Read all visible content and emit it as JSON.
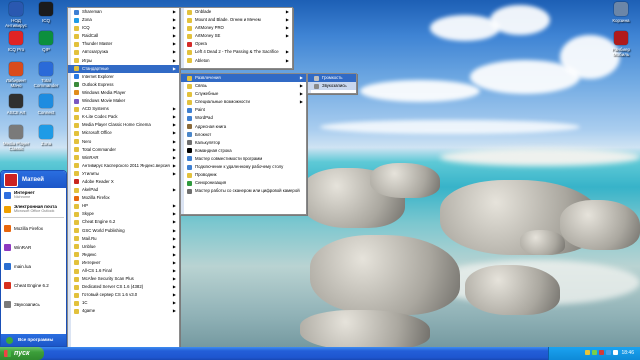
{
  "desktop": {
    "icons": [
      {
        "label": "НОД Антивирус",
        "color": "#2a58b0"
      },
      {
        "label": "ICQ",
        "color": "#1b1b1b"
      },
      {
        "label": "ICQ Pro",
        "color": "#e02424"
      },
      {
        "label": "QIP",
        "color": "#0c8f3e"
      },
      {
        "label": "Лабиринт Мачо",
        "color": "#d84b1c"
      },
      {
        "label": "Total Commander",
        "color": "#2a6ad8"
      },
      {
        "label": "ASCII Art",
        "color": "#303030"
      },
      {
        "label": "Connect",
        "color": "#1e8ce0"
      },
      {
        "label": "Media Player Classic",
        "color": "#7a7a7a"
      },
      {
        "label": "Zona",
        "color": "#1e9be6"
      }
    ],
    "right_icons": [
      {
        "label": "Корзина",
        "color": "#6b86a8"
      },
      {
        "label": "Ранбиер Мобиль",
        "color": "#b01b1b"
      }
    ]
  },
  "start_menu": {
    "user": "Матвей",
    "pinned": [
      {
        "title": "Интернет",
        "sub": "Nichrome",
        "color": "#2f6fe0"
      },
      {
        "title": "Электронная почта",
        "sub": "Microsoft Office Outlook",
        "color": "#f0a000"
      }
    ],
    "recent": [
      {
        "label": "Mozilla Firefox",
        "color": "#e8660d"
      },
      {
        "label": "WinRAR",
        "color": "#8e3ac0"
      },
      {
        "label": "main.lua",
        "color": "#2b6fd2"
      },
      {
        "label": "Cheat Engine 6.2",
        "color": "#d8301e"
      },
      {
        "label": "Звукозапись",
        "color": "#7a7a7a"
      }
    ],
    "all_programs": "Все программы"
  },
  "programs_menu": [
    {
      "label": "Shareman",
      "color": "#3d7fd3",
      "sub": true
    },
    {
      "label": "Zona",
      "color": "#1e9be6",
      "sub": true
    },
    {
      "label": "ICQ",
      "color": "#e2c13c",
      "sub": true
    },
    {
      "label": "RaidCall",
      "color": "#e2c13c",
      "sub": true
    },
    {
      "label": "Thunder Master",
      "color": "#e2c13c",
      "sub": true
    },
    {
      "label": "Автозагрузка",
      "color": "#e2c13c",
      "sub": true
    },
    {
      "label": "Игры",
      "color": "#e2c13c",
      "sub": true
    },
    {
      "label": "Стандартные",
      "color": "#e2c13c",
      "sub": true,
      "state": "hl"
    },
    {
      "label": "Internet Explorer",
      "color": "#2a7ae2",
      "sub": false
    },
    {
      "label": "Outlook Express",
      "color": "#3a8a3a",
      "sub": false
    },
    {
      "label": "Windows Media Player",
      "color": "#e08c1b",
      "sub": false
    },
    {
      "label": "Windows Movie Maker",
      "color": "#7a57c2",
      "sub": false
    },
    {
      "label": "ACD Systems",
      "color": "#e2c13c",
      "sub": true
    },
    {
      "label": "K-Lite Codec Pack",
      "color": "#e2c13c",
      "sub": true
    },
    {
      "label": "Media Player Classic Home Cinema",
      "color": "#e2c13c",
      "sub": true
    },
    {
      "label": "Microsoft Office",
      "color": "#e2c13c",
      "sub": true
    },
    {
      "label": "Nero",
      "color": "#e2c13c",
      "sub": true
    },
    {
      "label": "Total Commander",
      "color": "#e2c13c",
      "sub": true
    },
    {
      "label": "WinRAR",
      "color": "#e2c13c",
      "sub": true
    },
    {
      "label": "Антивирус Касперского 2011 Яндекс.версия",
      "color": "#e2c13c",
      "sub": true
    },
    {
      "label": "Утилиты",
      "color": "#e2c13c",
      "sub": true
    },
    {
      "label": "Adobe Reader X",
      "color": "#c8261e",
      "sub": false
    },
    {
      "label": "AkelPad",
      "color": "#e2c13c",
      "sub": true
    },
    {
      "label": "Mozilla Firefox",
      "color": "#e8660d",
      "sub": false
    },
    {
      "label": "HP",
      "color": "#e2c13c",
      "sub": true
    },
    {
      "label": "Skype",
      "color": "#e2c13c",
      "sub": true
    },
    {
      "label": "Cheat Engine 6.2",
      "color": "#e2c13c",
      "sub": true
    },
    {
      "label": "GSC World Publishing",
      "color": "#e2c13c",
      "sub": true
    },
    {
      "label": "Mail.Ru",
      "color": "#e2c13c",
      "sub": true
    },
    {
      "label": "Unblue",
      "color": "#e2c13c",
      "sub": true
    },
    {
      "label": "Яндекс",
      "color": "#e2c13c",
      "sub": true
    },
    {
      "label": "Интернет",
      "color": "#e2c13c",
      "sub": true
    },
    {
      "label": "All-CS 1.6 Final",
      "color": "#e2c13c",
      "sub": true
    },
    {
      "label": "McAfee Security Scan Plus",
      "color": "#e2c13c",
      "sub": true
    },
    {
      "label": "Dedicated Server CS 1.6 (4382)",
      "color": "#e2c13c",
      "sub": true
    },
    {
      "label": "Готовый сервер CS 1.6 v3.0",
      "color": "#e2c13c",
      "sub": true
    },
    {
      "label": "1C",
      "color": "#e2c13c",
      "sub": true
    },
    {
      "label": "4game",
      "color": "#e2c13c",
      "sub": true
    }
  ],
  "standard_top": [
    {
      "label": "Onblade",
      "color": "#e2c13c",
      "sub": true
    },
    {
      "label": "Mount and Blade. Огнем и Мечем",
      "color": "#e2c13c",
      "sub": true
    },
    {
      "label": "ArtMoney PRO",
      "color": "#e2c13c",
      "sub": true
    },
    {
      "label": "ArtMoney SE",
      "color": "#e2c13c",
      "sub": true
    },
    {
      "label": "Opera",
      "color": "#d42a2a",
      "sub": false
    },
    {
      "label": "Left 4 Dead 2 - The Passing & The Sacrifice",
      "color": "#e2c13c",
      "sub": true
    },
    {
      "label": "Ableton",
      "color": "#e2c13c",
      "sub": true
    }
  ],
  "standard_menu": [
    {
      "label": "Развлечения",
      "color": "#e2c13c",
      "sub": true,
      "state": "hl"
    },
    {
      "label": "Связь",
      "color": "#e2c13c",
      "sub": true
    },
    {
      "label": "Служебные",
      "color": "#e2c13c",
      "sub": true
    },
    {
      "label": "Специальные возможности",
      "color": "#e2c13c",
      "sub": true
    },
    {
      "label": "Paint",
      "color": "#3e7fd1",
      "sub": false
    },
    {
      "label": "WordPad",
      "color": "#3e7fd1",
      "sub": false
    },
    {
      "label": "Адресная книга",
      "color": "#8a6a3a",
      "sub": false
    },
    {
      "label": "Блокнот",
      "color": "#4a86c9",
      "sub": false
    },
    {
      "label": "Калькулятор",
      "color": "#6f6f6f",
      "sub": false
    },
    {
      "label": "Командная строка",
      "color": "#000000",
      "sub": false
    },
    {
      "label": "Мастер совместимости программ",
      "color": "#3e7fd1",
      "sub": false
    },
    {
      "label": "Подключение к удаленному рабочему столу",
      "color": "#3e7fd1",
      "sub": false
    },
    {
      "label": "Проводник",
      "color": "#e2c13c",
      "sub": false
    },
    {
      "label": "Синхронизация",
      "color": "#2f9a3e",
      "sub": false
    },
    {
      "label": "Мастер работы со сканером или цифровой камерой",
      "color": "#6f6f6f",
      "sub": false
    }
  ],
  "fun_menu": [
    {
      "label": "Громкость",
      "color": "#bfbfbf",
      "state": "hl"
    },
    {
      "label": "Звукозапись",
      "color": "#8a8a8a",
      "state": "sel"
    }
  ],
  "taskbar": {
    "start_label": "пуск",
    "clock": "18:46",
    "tray_colors": [
      "#e8c43a",
      "#7ad04a",
      "#d43a3a",
      "#4aa0e8",
      "#ffffff"
    ]
  }
}
